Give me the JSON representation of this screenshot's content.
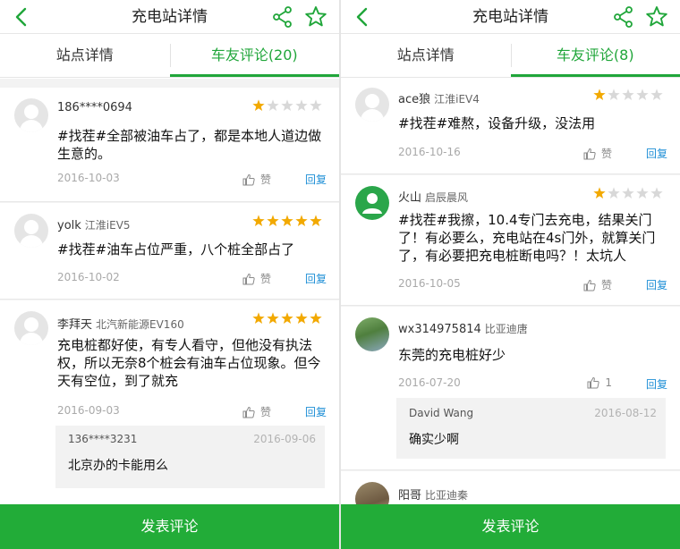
{
  "colors": {
    "accent": "#20a63a",
    "button": "#22ac38",
    "reply": "#1e8fd6",
    "star": "#f2a900",
    "star_empty": "#d8d8d8"
  },
  "left": {
    "header": {
      "title": "充电站详情"
    },
    "tabs": [
      {
        "label": "站点详情"
      },
      {
        "label": "车友评论(20)"
      }
    ],
    "comments": [
      {
        "name": "186****0694",
        "car": "",
        "rating": 1,
        "text": "#找茬#全部被油车占了，都是本地人道边做生意的。",
        "date": "2016-10-03",
        "like": "赞",
        "reply": "回复"
      },
      {
        "name": "yolk",
        "car": "江淮iEV5",
        "rating": 5,
        "text": "#找茬#油车占位严重，八个桩全部占了",
        "date": "2016-10-02",
        "like": "赞",
        "reply": "回复"
      },
      {
        "name": "李拜天",
        "car": "北汽新能源EV160",
        "rating": 5,
        "text": "充电桩都好使，有专人看守，但他没有执法权，所以无奈8个桩会有油车占位现象。但今天有空位，到了就充",
        "date": "2016-09-03",
        "like": "赞",
        "reply": "回复",
        "sub": {
          "name": "136****3231",
          "date": "2016-09-06",
          "text": "北京办的卡能用么"
        }
      }
    ],
    "footer": {
      "button_label": "发表评论"
    }
  },
  "right": {
    "header": {
      "title": "充电站详情"
    },
    "tabs": [
      {
        "label": "站点详情"
      },
      {
        "label": "车友评论(8)"
      }
    ],
    "comments": [
      {
        "name": "ace狼",
        "car": "江淮iEV4",
        "rating": 1,
        "text": "#找茬#难熬，设备升级，没法用",
        "date": "2016-10-16",
        "like": "赞",
        "reply": "回复"
      },
      {
        "name": "火山",
        "car": "启辰晨风",
        "rating": 1,
        "text": "#找茬#我擦，10.4专门去充电，结果关门了！有必要么，充电站在4s门外，就算关门了，有必要把充电桩断电吗？！太坑人",
        "date": "2016-10-05",
        "like": "赞",
        "reply": "回复"
      },
      {
        "name": "wx314975814",
        "car": "比亚迪唐",
        "rating": 0,
        "text": "东莞的充电桩好少",
        "date": "2016-07-20",
        "like": "1",
        "reply": "回复",
        "sub": {
          "name": "David Wang",
          "date": "2016-08-12",
          "text": "确实少啊"
        }
      },
      {
        "name": "阳哥",
        "car": "比亚迪秦",
        "rating": 0,
        "text": "",
        "date": "",
        "like": "",
        "reply": ""
      }
    ],
    "footer": {
      "button_label": "发表评论"
    }
  }
}
